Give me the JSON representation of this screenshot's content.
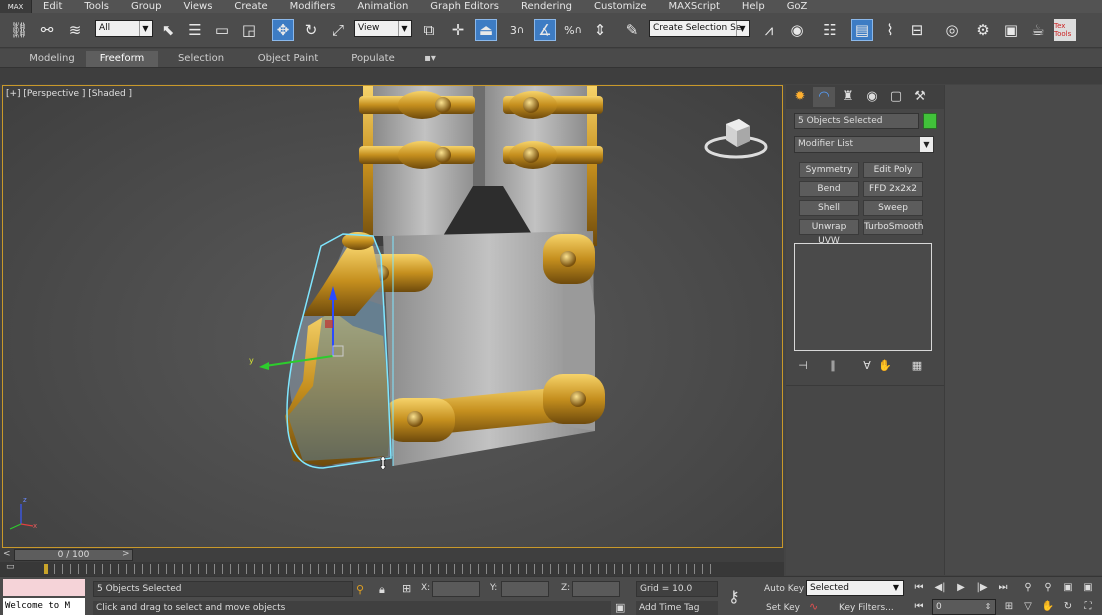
{
  "app": {
    "logo": "MAX"
  },
  "menu": [
    "Edit",
    "Tools",
    "Group",
    "Views",
    "Create",
    "Modifiers",
    "Animation",
    "Graph Editors",
    "Rendering",
    "Customize",
    "MAXScript",
    "Help",
    "GoZ"
  ],
  "toolbar": {
    "selection_filter": "All",
    "ref_coord": "View",
    "snap_value": "3",
    "angle_snap": "%",
    "named_selection": "Create Selection Se",
    "texture_tools": "Tex Tools"
  },
  "ribbon": {
    "tabs": [
      "Modeling",
      "Freeform",
      "Selection",
      "Object Paint",
      "Populate"
    ],
    "active": "Freeform"
  },
  "viewport": {
    "label": "[+] [Perspective ] [Shaded ]",
    "axis_y": "y",
    "corner_axis_z": "z",
    "corner_axis_x": "x"
  },
  "command_panel": {
    "tabs": [
      "create-icon",
      "modify-icon",
      "hierarchy-icon",
      "motion-icon",
      "display-icon",
      "utilities-icon"
    ],
    "object_name": "5 Objects Selected",
    "object_color": "#41c23a",
    "modifier_list": "Modifier List",
    "modifier_buttons": [
      "Symmetry",
      "Edit Poly",
      "Bend",
      "FFD 2x2x2",
      "Shell",
      "Sweep",
      "Unwrap UVW",
      "TurboSmooth"
    ]
  },
  "timeslider": {
    "frame": "0 / 100",
    "prev": "<",
    "next": ">"
  },
  "status": {
    "selection": "5 Objects Selected",
    "prompt": "Click and drag to select and move objects",
    "listener": "Welcome to M",
    "x_label": "X:",
    "y_label": "Y:",
    "z_label": "Z:",
    "grid": "Grid = 10.0",
    "add_time_tag": "Add Time Tag",
    "auto_key": "Auto Key",
    "set_key": "Set Key",
    "key_mode": "Selected",
    "key_filters": "Key Filters...",
    "current_frame": "0"
  }
}
